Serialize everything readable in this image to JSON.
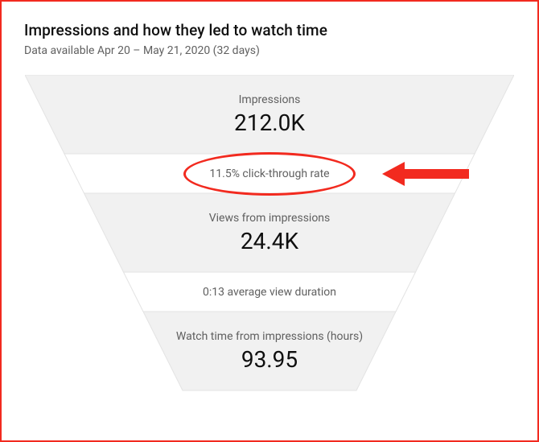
{
  "header": {
    "title": "Impressions and how they led to watch time",
    "subtitle": "Data available Apr 20 – May 21, 2020 (32 days)"
  },
  "funnel": {
    "impressions": {
      "label": "Impressions",
      "value": "212.0K"
    },
    "ctr": {
      "text": "11.5% click-through rate"
    },
    "views": {
      "label": "Views from impressions",
      "value": "24.4K"
    },
    "avd": {
      "text": "0:13 average view duration"
    },
    "watchtime": {
      "label": "Watch time from impressions (hours)",
      "value": "93.95"
    }
  },
  "chart_data": {
    "type": "table",
    "title": "Impressions and how they led to watch time",
    "date_range": "Apr 20 – May 21, 2020",
    "days": 32,
    "rows": [
      {
        "metric": "Impressions",
        "value": 212000,
        "display": "212.0K"
      },
      {
        "metric": "Click-through rate",
        "value": 0.115,
        "display": "11.5%"
      },
      {
        "metric": "Views from impressions",
        "value": 24400,
        "display": "24.4K"
      },
      {
        "metric": "Average view duration",
        "value_seconds": 13,
        "display": "0:13"
      },
      {
        "metric": "Watch time from impressions (hours)",
        "value": 93.95,
        "display": "93.95"
      }
    ]
  }
}
